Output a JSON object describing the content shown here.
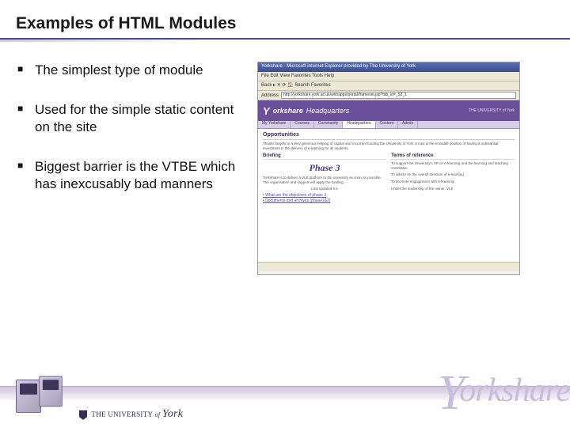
{
  "slide": {
    "title": "Examples of HTML Modules",
    "bullets": [
      "The simplest type of module",
      "Used for the simple static content on the site",
      "Biggest barrier is the VTBE which has inexcusably bad manners"
    ]
  },
  "screenshot": {
    "window_title": "Yorkshare - Microsoft Internet Explorer provided by The University of York",
    "menubar": "File   Edit   View   Favorites   Tools   Help",
    "toolbar": "Back  ▸  ✕  ⟳  🏠   Search   Favorites",
    "address_label": "Address",
    "address_value": "http://yorkshare.york.ac.uk/webapps/portal/frameset.jsp?tab_id=_52_1",
    "banner_brand": "orkshare",
    "banner_section": "Headquarters",
    "banner_right": "THE UNIVERSITY of York",
    "tabs": [
      "My Yorkshare",
      "Courses",
      "Community",
      "Headquarters",
      "Content",
      "Admin"
    ],
    "page_heading": "Opportunities",
    "intro": "Thanks largely to a very generous helping of capital and recurrent funding the University of York is now in the enviable position of having a substantial investment in the delivery of e-learning for its students.",
    "left_col_title": "Briefing",
    "phase_label": "Phase 3",
    "phase_sub": "Yorkshare is to deliver a VLE platform to the university as soon as possible. The organisation and support will apply the funding.",
    "phase_date": "Last updated 8.5",
    "links": [
      "• What are the objectives of phase 3",
      "• Documents and archives (phase1&2)"
    ],
    "right_col_title": "Terms of reference",
    "right_items": [
      "To support the University's VP on e-learning and the learning and teaching committee",
      "To advise on the overall direction of e-learning",
      "To promote engagement with e-learning"
    ],
    "right_sub": "Under the leadership of the owner, VLE"
  },
  "footer": {
    "university": "THE UNIVERSITY",
    "of": "of",
    "york": "York",
    "brand_rest": "orkshare"
  }
}
